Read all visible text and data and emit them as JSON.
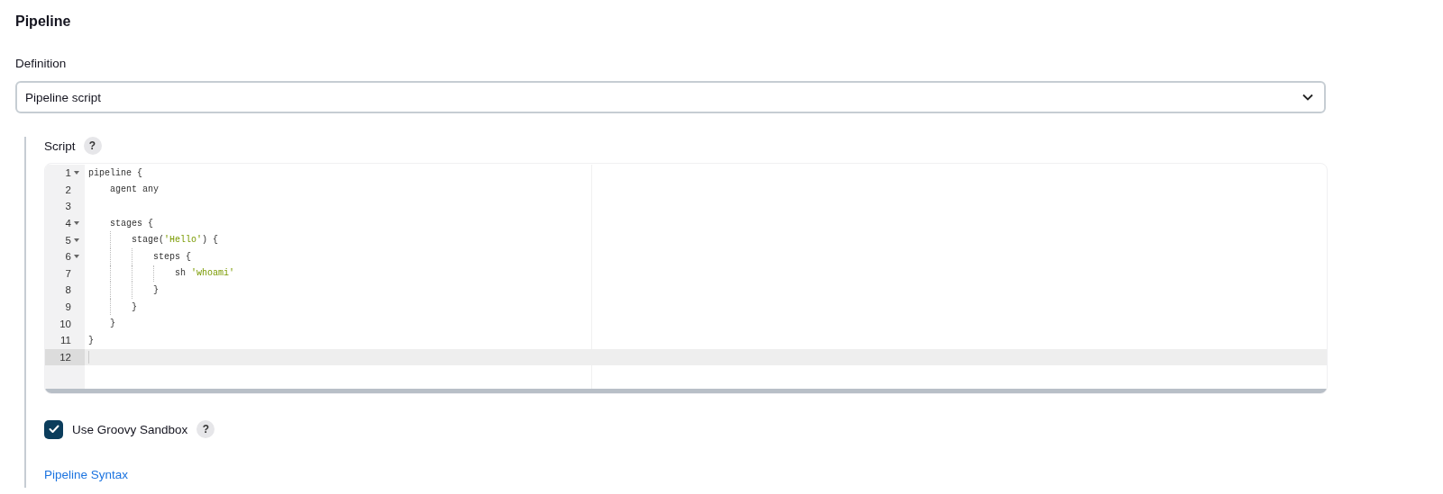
{
  "section": {
    "title": "Pipeline"
  },
  "definition": {
    "label": "Definition",
    "value": "Pipeline script"
  },
  "script": {
    "label": "Script",
    "help": "?",
    "lines": [
      {
        "number": "1",
        "foldable": true,
        "selected": false,
        "tokens": [
          {
            "kind": "plain",
            "text": "pipeline {"
          }
        ]
      },
      {
        "number": "2",
        "foldable": false,
        "selected": false,
        "tokens": [
          {
            "kind": "plain",
            "text": "    agent any"
          }
        ]
      },
      {
        "number": "3",
        "foldable": false,
        "selected": false
      },
      {
        "number": "4",
        "foldable": true,
        "selected": false,
        "tokens": [
          {
            "kind": "plain",
            "text": "    stages {"
          }
        ]
      },
      {
        "number": "5",
        "foldable": true,
        "selected": false,
        "tokens": [
          {
            "kind": "plain",
            "text": "        stage("
          },
          {
            "kind": "string",
            "text": "'Hello'"
          },
          {
            "kind": "plain",
            "text": ") {"
          }
        ]
      },
      {
        "number": "6",
        "foldable": true,
        "selected": false,
        "tokens": [
          {
            "kind": "plain",
            "text": "            steps {"
          }
        ]
      },
      {
        "number": "7",
        "foldable": false,
        "selected": false,
        "tokens": [
          {
            "kind": "plain",
            "text": "                sh "
          },
          {
            "kind": "string",
            "text": "'whoami'"
          }
        ]
      },
      {
        "number": "8",
        "foldable": false,
        "selected": false,
        "tokens": [
          {
            "kind": "plain",
            "text": "            }"
          }
        ]
      },
      {
        "number": "9",
        "foldable": false,
        "selected": false,
        "tokens": [
          {
            "kind": "plain",
            "text": "        }"
          }
        ]
      },
      {
        "number": "10",
        "foldable": false,
        "selected": false,
        "tokens": [
          {
            "kind": "plain",
            "text": "    }"
          }
        ]
      },
      {
        "number": "11",
        "foldable": false,
        "selected": false,
        "tokens": [
          {
            "kind": "plain",
            "text": "}"
          }
        ]
      },
      {
        "number": "12",
        "foldable": false,
        "selected": true
      }
    ]
  },
  "sandbox": {
    "label": "Use Groovy Sandbox",
    "checked": true,
    "help": "?"
  },
  "link": {
    "text": "Pipeline Syntax"
  }
}
